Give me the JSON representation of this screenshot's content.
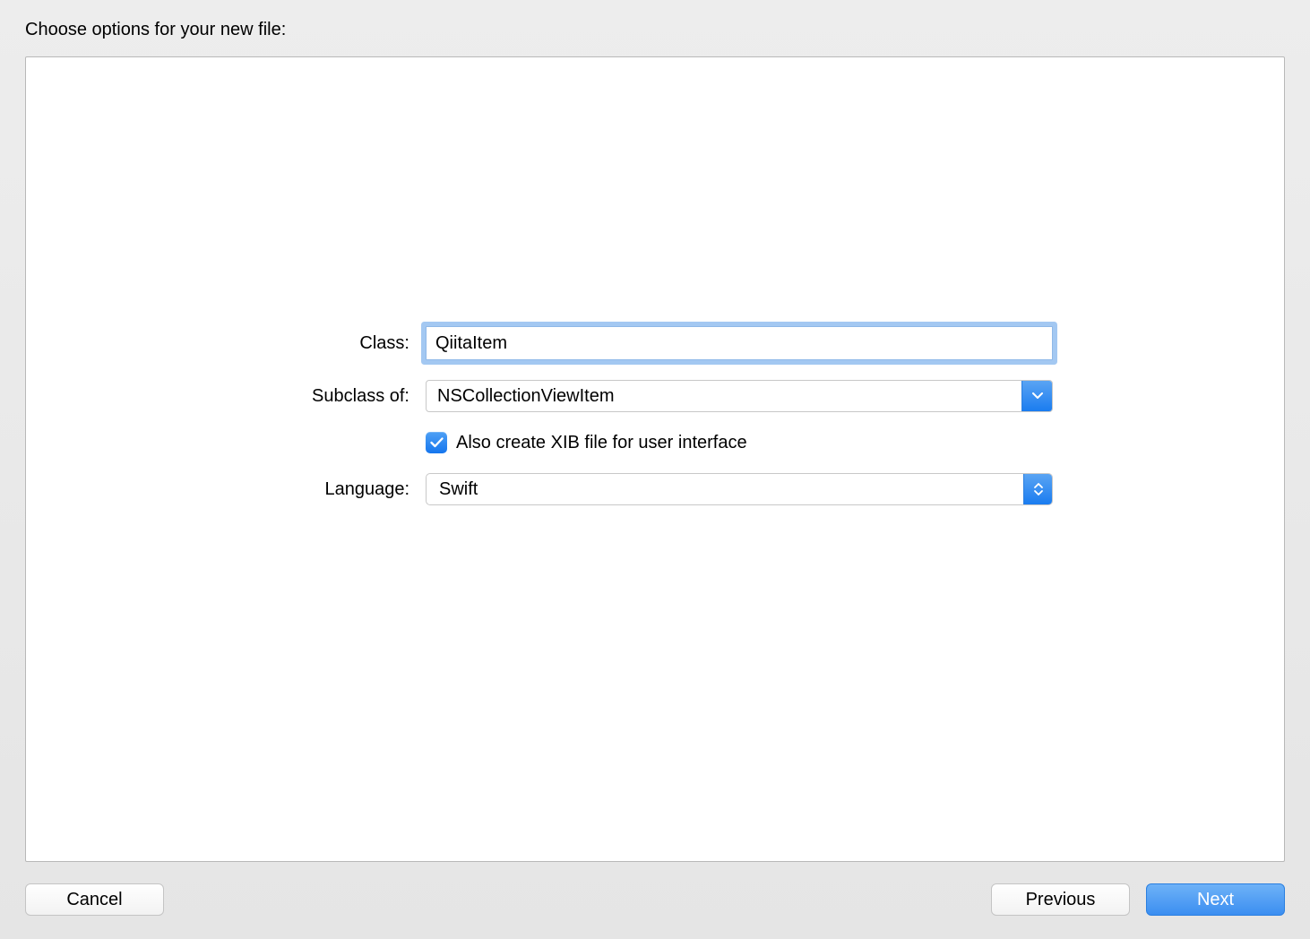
{
  "sheet": {
    "title": "Choose options for your new file:"
  },
  "form": {
    "class": {
      "label": "Class:",
      "value": "QiitaItem"
    },
    "subclass": {
      "label": "Subclass of:",
      "value": "NSCollectionViewItem"
    },
    "xib": {
      "checked": true,
      "label": "Also create XIB file for user interface"
    },
    "language": {
      "label": "Language:",
      "value": "Swift"
    }
  },
  "footer": {
    "cancel": "Cancel",
    "previous": "Previous",
    "next": "Next"
  }
}
